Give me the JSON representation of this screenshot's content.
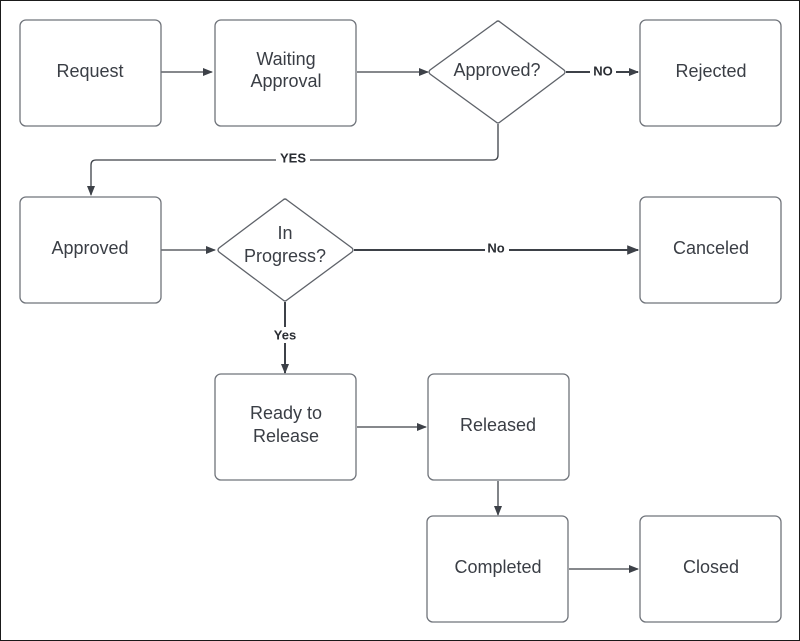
{
  "diagram": {
    "type": "flowchart",
    "nodes": {
      "request": {
        "shape": "rect",
        "lines": [
          "Request"
        ]
      },
      "waiting_approval": {
        "shape": "rect",
        "lines": [
          "Waiting",
          "Approval"
        ]
      },
      "approved_decision": {
        "shape": "diamond",
        "lines": [
          "Approved?"
        ]
      },
      "rejected": {
        "shape": "rect",
        "lines": [
          "Rejected"
        ]
      },
      "approved": {
        "shape": "rect",
        "lines": [
          "Approved"
        ]
      },
      "in_progress_decision": {
        "shape": "diamond",
        "lines": [
          "In",
          "Progress?"
        ]
      },
      "canceled": {
        "shape": "rect",
        "lines": [
          "Canceled"
        ]
      },
      "ready_to_release": {
        "shape": "rect",
        "lines": [
          "Ready to",
          "Release"
        ]
      },
      "released": {
        "shape": "rect",
        "lines": [
          "Released"
        ]
      },
      "completed": {
        "shape": "rect",
        "lines": [
          "Completed"
        ]
      },
      "closed": {
        "shape": "rect",
        "lines": [
          "Closed"
        ]
      }
    },
    "edges": [
      {
        "from": "request",
        "to": "waiting_approval",
        "label": ""
      },
      {
        "from": "waiting_approval",
        "to": "approved_decision",
        "label": ""
      },
      {
        "from": "approved_decision",
        "to": "rejected",
        "label": "NO"
      },
      {
        "from": "approved_decision",
        "to": "approved",
        "label": "YES"
      },
      {
        "from": "approved",
        "to": "in_progress_decision",
        "label": ""
      },
      {
        "from": "in_progress_decision",
        "to": "canceled",
        "label": "No"
      },
      {
        "from": "in_progress_decision",
        "to": "ready_to_release",
        "label": "Yes"
      },
      {
        "from": "ready_to_release",
        "to": "released",
        "label": ""
      },
      {
        "from": "released",
        "to": "completed",
        "label": ""
      },
      {
        "from": "completed",
        "to": "closed",
        "label": ""
      }
    ]
  }
}
